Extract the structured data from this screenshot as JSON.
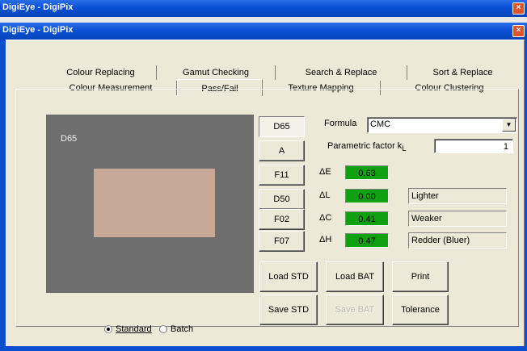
{
  "window": {
    "outer_title": "DigiEye - DigiPix",
    "inner_title": "DigiEye - DigiPix"
  },
  "tabs_row1": [
    "Colour Replacing",
    "Gamut Checking",
    "Search & Replace",
    "Sort & Replace"
  ],
  "tabs_row2": [
    "Colour Measurement",
    "Pass/Fail",
    "Texture Mapping",
    "Colour Clustering"
  ],
  "active_tab": "Pass/Fail",
  "preview": {
    "illuminant_label": "D65",
    "swatch_color": "#c8a896"
  },
  "illuminants": [
    "D65",
    "A",
    "F11",
    "D50",
    "F02",
    "F07"
  ],
  "selected_illuminant": "D65",
  "formula": {
    "label": "Formula",
    "value": "CMC"
  },
  "parametric": {
    "label": "Parametric factor k",
    "subscript": "L",
    "value": "1"
  },
  "metrics": {
    "dE": {
      "label": "ΔE",
      "value": "0.63"
    },
    "dL": {
      "label": "ΔL",
      "value": "0.00",
      "desc": "Lighter"
    },
    "dC": {
      "label": "ΔC",
      "value": "0.41",
      "desc": "Weaker"
    },
    "dH": {
      "label": "ΔH",
      "value": "0.47",
      "desc": "Redder (Bluer)"
    }
  },
  "pass_color": "#0fa10f",
  "buttons": {
    "load_std": "Load STD",
    "load_bat": "Load BAT",
    "print": "Print",
    "save_std": "Save STD",
    "save_bat": "Save BAT",
    "tolerance": "Tolerance"
  },
  "radios": {
    "standard": "Standard",
    "batch": "Batch",
    "selected": "Standard"
  }
}
